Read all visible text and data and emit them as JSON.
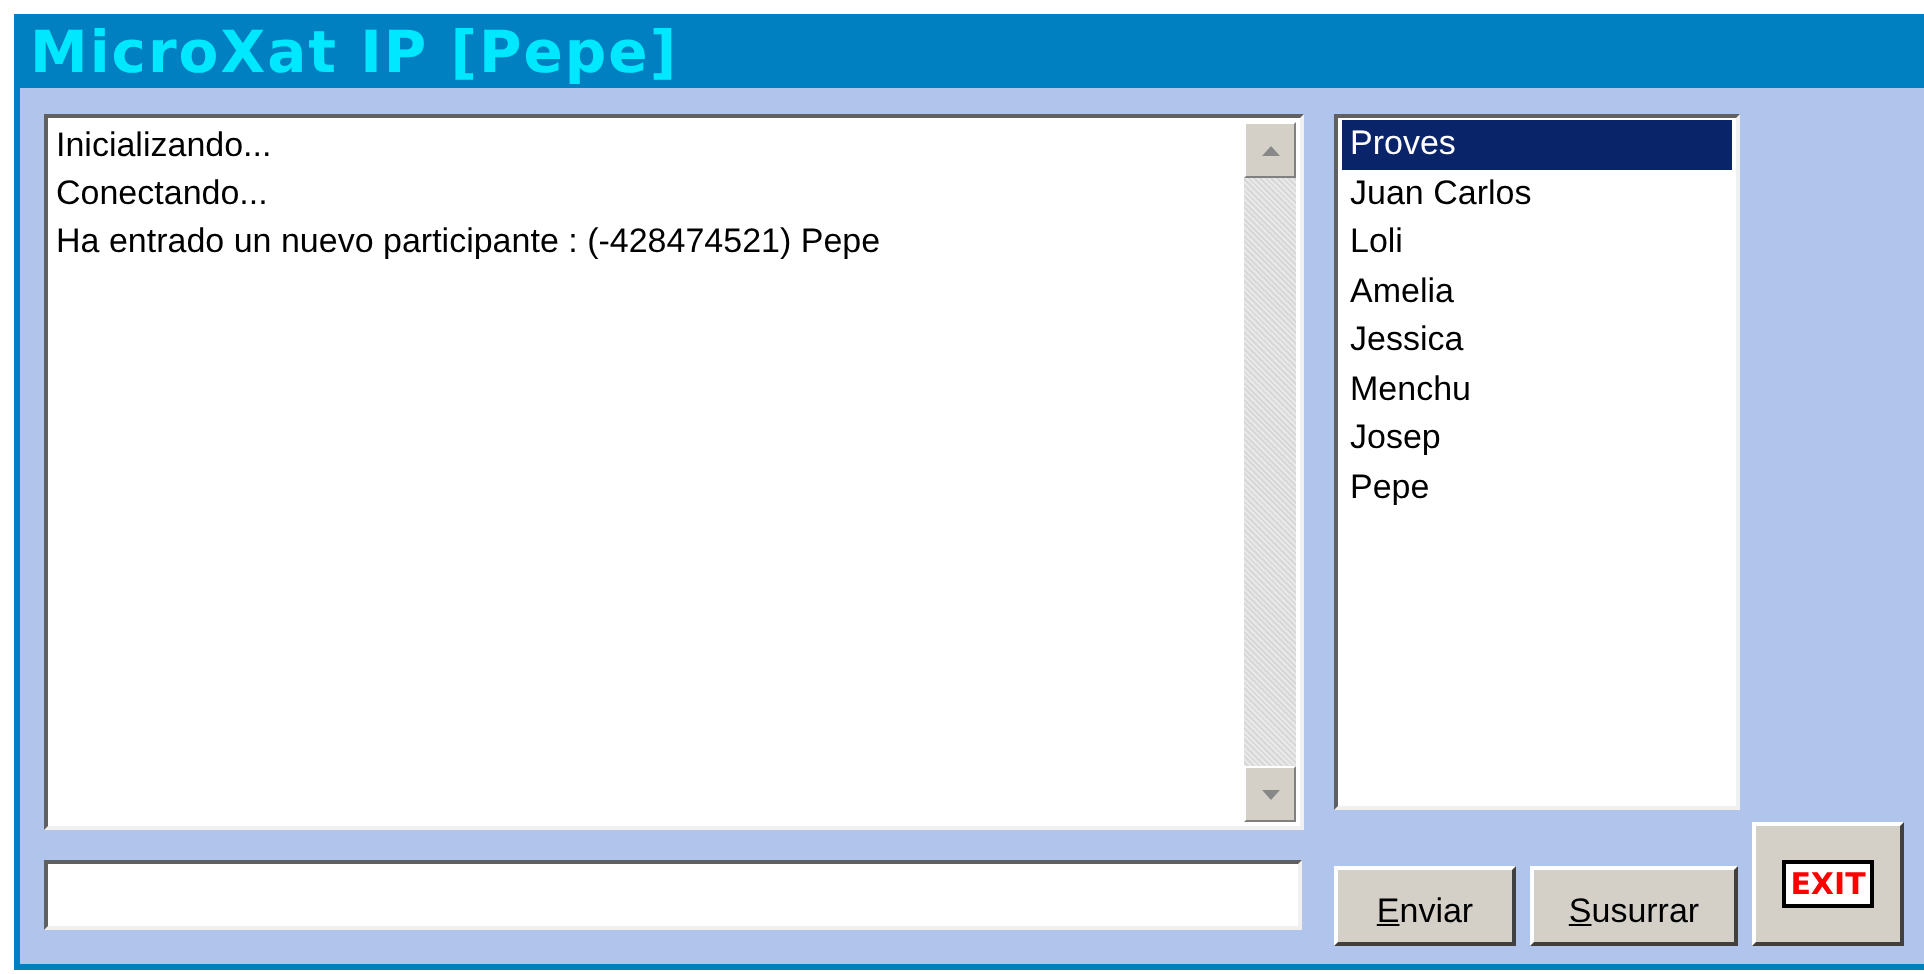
{
  "window": {
    "title": "MicroXat IP [Pepe]"
  },
  "log": {
    "lines": [
      "Inicializando...",
      "Conectando...",
      "Ha entrado un nuevo participante : (-428474521) Pepe"
    ]
  },
  "participants": [
    {
      "name": "Proves",
      "selected": true
    },
    {
      "name": "Juan Carlos",
      "selected": false
    },
    {
      "name": "Loli",
      "selected": false
    },
    {
      "name": "Amelia",
      "selected": false
    },
    {
      "name": "Jessica",
      "selected": false
    },
    {
      "name": "Menchu",
      "selected": false
    },
    {
      "name": "Josep",
      "selected": false
    },
    {
      "name": "Pepe",
      "selected": false
    }
  ],
  "buttons": [
    "Enviar",
    "Susurrar"
  ],
  "exit_button": {
    "label": "EXIT"
  }
}
